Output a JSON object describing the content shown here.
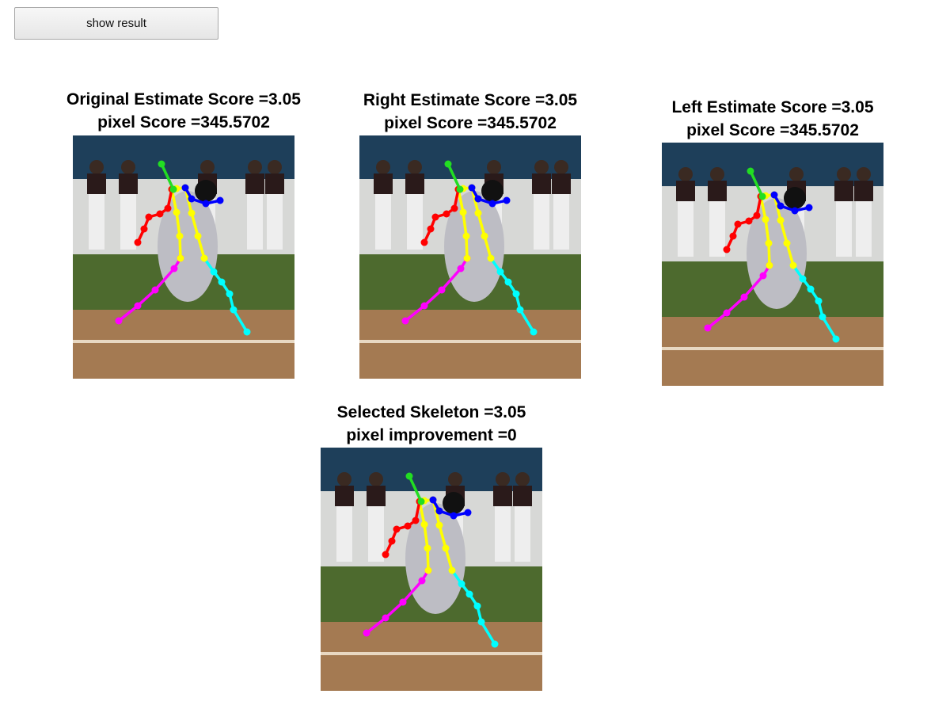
{
  "toolbar": {
    "show_result_label": "show result"
  },
  "panels": [
    {
      "id": "original",
      "title_line1": "Original Estimate Score =3.05",
      "title_line2": "pixel Score =345.5702"
    },
    {
      "id": "right",
      "title_line1": "Right Estimate Score =3.05",
      "title_line2": "pixel Score =345.5702"
    },
    {
      "id": "left",
      "title_line1": "Left Estimate Score =3.05",
      "title_line2": "pixel Score =345.5702"
    },
    {
      "id": "selected",
      "title_line1": "Selected Skeleton =3.05",
      "title_line2": "pixel improvement =0"
    }
  ],
  "skeleton_colors": {
    "head": "#22dd22",
    "torso": "#ffff00",
    "left_arm": "#ff0000",
    "right_arm": "#0000ff",
    "left_leg": "#ff00ff",
    "right_leg": "#00ffff"
  }
}
